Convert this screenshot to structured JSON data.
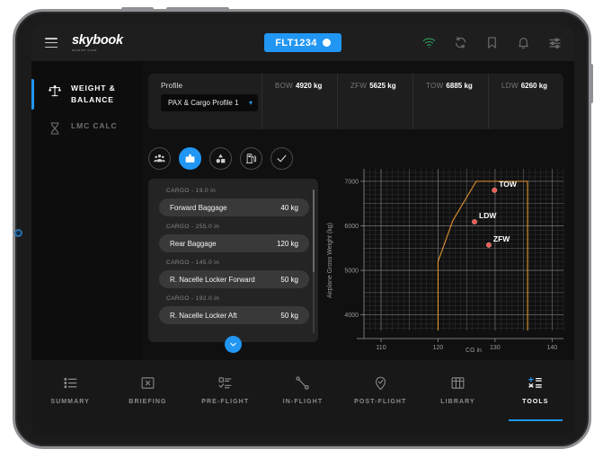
{
  "app": {
    "logo_word": "skybook",
    "logo_sub": "aviation cloud",
    "flight_label": "FLT1234"
  },
  "topbar": {
    "menu_icon": "hamburger-menu-icon",
    "icons": [
      {
        "name": "wifi-icon",
        "color": "#2e9e5b"
      },
      {
        "name": "sync-icon",
        "color": "#6e6e6e"
      },
      {
        "name": "bookmark-icon",
        "color": "#6e6e6e"
      },
      {
        "name": "bell-icon",
        "color": "#6e6e6e"
      },
      {
        "name": "settings-sliders-icon",
        "color": "#6e6e6e"
      }
    ]
  },
  "sidebar": {
    "items": [
      {
        "label": "WEIGHT &\nBALANCE",
        "icon": "scales-icon",
        "active": true
      },
      {
        "label": "LMC CALC",
        "icon": "hourglass-icon",
        "active": false
      }
    ]
  },
  "profile": {
    "label": "Profile",
    "selected": "PAX & Cargo Profile 1",
    "chevron": "chevron-down-icon",
    "weights": [
      {
        "key": "BOW",
        "value": "4920 kg"
      },
      {
        "key": "ZFW",
        "value": "5625 kg"
      },
      {
        "key": "TOW",
        "value": "6885 kg"
      },
      {
        "key": "LDW",
        "value": "6260 kg"
      }
    ]
  },
  "tabs": [
    {
      "name": "passengers-tab",
      "icon": "passengers-icon",
      "active": false
    },
    {
      "name": "cargo-tab",
      "icon": "cargo-box-icon",
      "active": true
    },
    {
      "name": "items-tab",
      "icon": "items-icon",
      "active": false
    },
    {
      "name": "fuel-tab",
      "icon": "fuel-pump-icon",
      "active": false
    },
    {
      "name": "confirm-tab",
      "icon": "check-icon",
      "active": false
    }
  ],
  "cargo": {
    "groups": [
      {
        "station": "CARGO - 19.0 in",
        "name": "Forward Baggage",
        "weight": "40 kg"
      },
      {
        "station": "CARGO - 255.0 in",
        "name": "Rear Baggage",
        "weight": "120 kg"
      },
      {
        "station": "CARGO - 145.0 in",
        "name": "R. Nacelle Locker Forward",
        "weight": "50 kg"
      },
      {
        "station": "CARGO - 192.0 in",
        "name": "R. Nacelle Locker Aft",
        "weight": "50 kg"
      }
    ],
    "collapse_icon": "chevron-down-icon"
  },
  "chart_data": {
    "type": "scatter",
    "title": "",
    "xlabel": "CG in",
    "ylabel": "Airplane Gross Weight (kg)",
    "xlim": [
      107,
      142
    ],
    "ylim": [
      3650,
      7280
    ],
    "xticks": [
      110,
      120,
      130,
      140
    ],
    "yticks": [
      4000,
      5000,
      6000,
      7000
    ],
    "grid": true,
    "minor_grid": true,
    "legend": "none",
    "envelope": {
      "name": "CG envelope",
      "color": "#e3932f",
      "points": [
        [
          120.0,
          3650
        ],
        [
          120.0,
          5200
        ],
        [
          122.6,
          6120
        ],
        [
          126.7,
          7000
        ],
        [
          135.7,
          7000
        ],
        [
          135.7,
          3650
        ]
      ]
    },
    "points": [
      {
        "label": "TOW",
        "x": 129.9,
        "y": 6800,
        "color": "#ee5a52"
      },
      {
        "label": "LDW",
        "x": 126.4,
        "y": 6090,
        "color": "#ee5a52"
      },
      {
        "label": "ZFW",
        "x": 128.9,
        "y": 5570,
        "color": "#ee5a52"
      }
    ]
  },
  "bottomnav": {
    "items": [
      {
        "label": "SUMMARY",
        "icon": "list-icon",
        "active": false
      },
      {
        "label": "BRIEFING",
        "icon": "briefing-doc-icon",
        "active": false
      },
      {
        "label": "PRE-FLIGHT",
        "icon": "checklist-icon",
        "active": false
      },
      {
        "label": "IN-FLIGHT",
        "icon": "route-icon",
        "active": false
      },
      {
        "label": "POST-FLIGHT",
        "icon": "location-check-icon",
        "active": false
      },
      {
        "label": "LIBRARY",
        "icon": "library-grid-icon",
        "active": false
      },
      {
        "label": "TOOLS",
        "icon": "calculator-icon",
        "active": true
      }
    ]
  }
}
